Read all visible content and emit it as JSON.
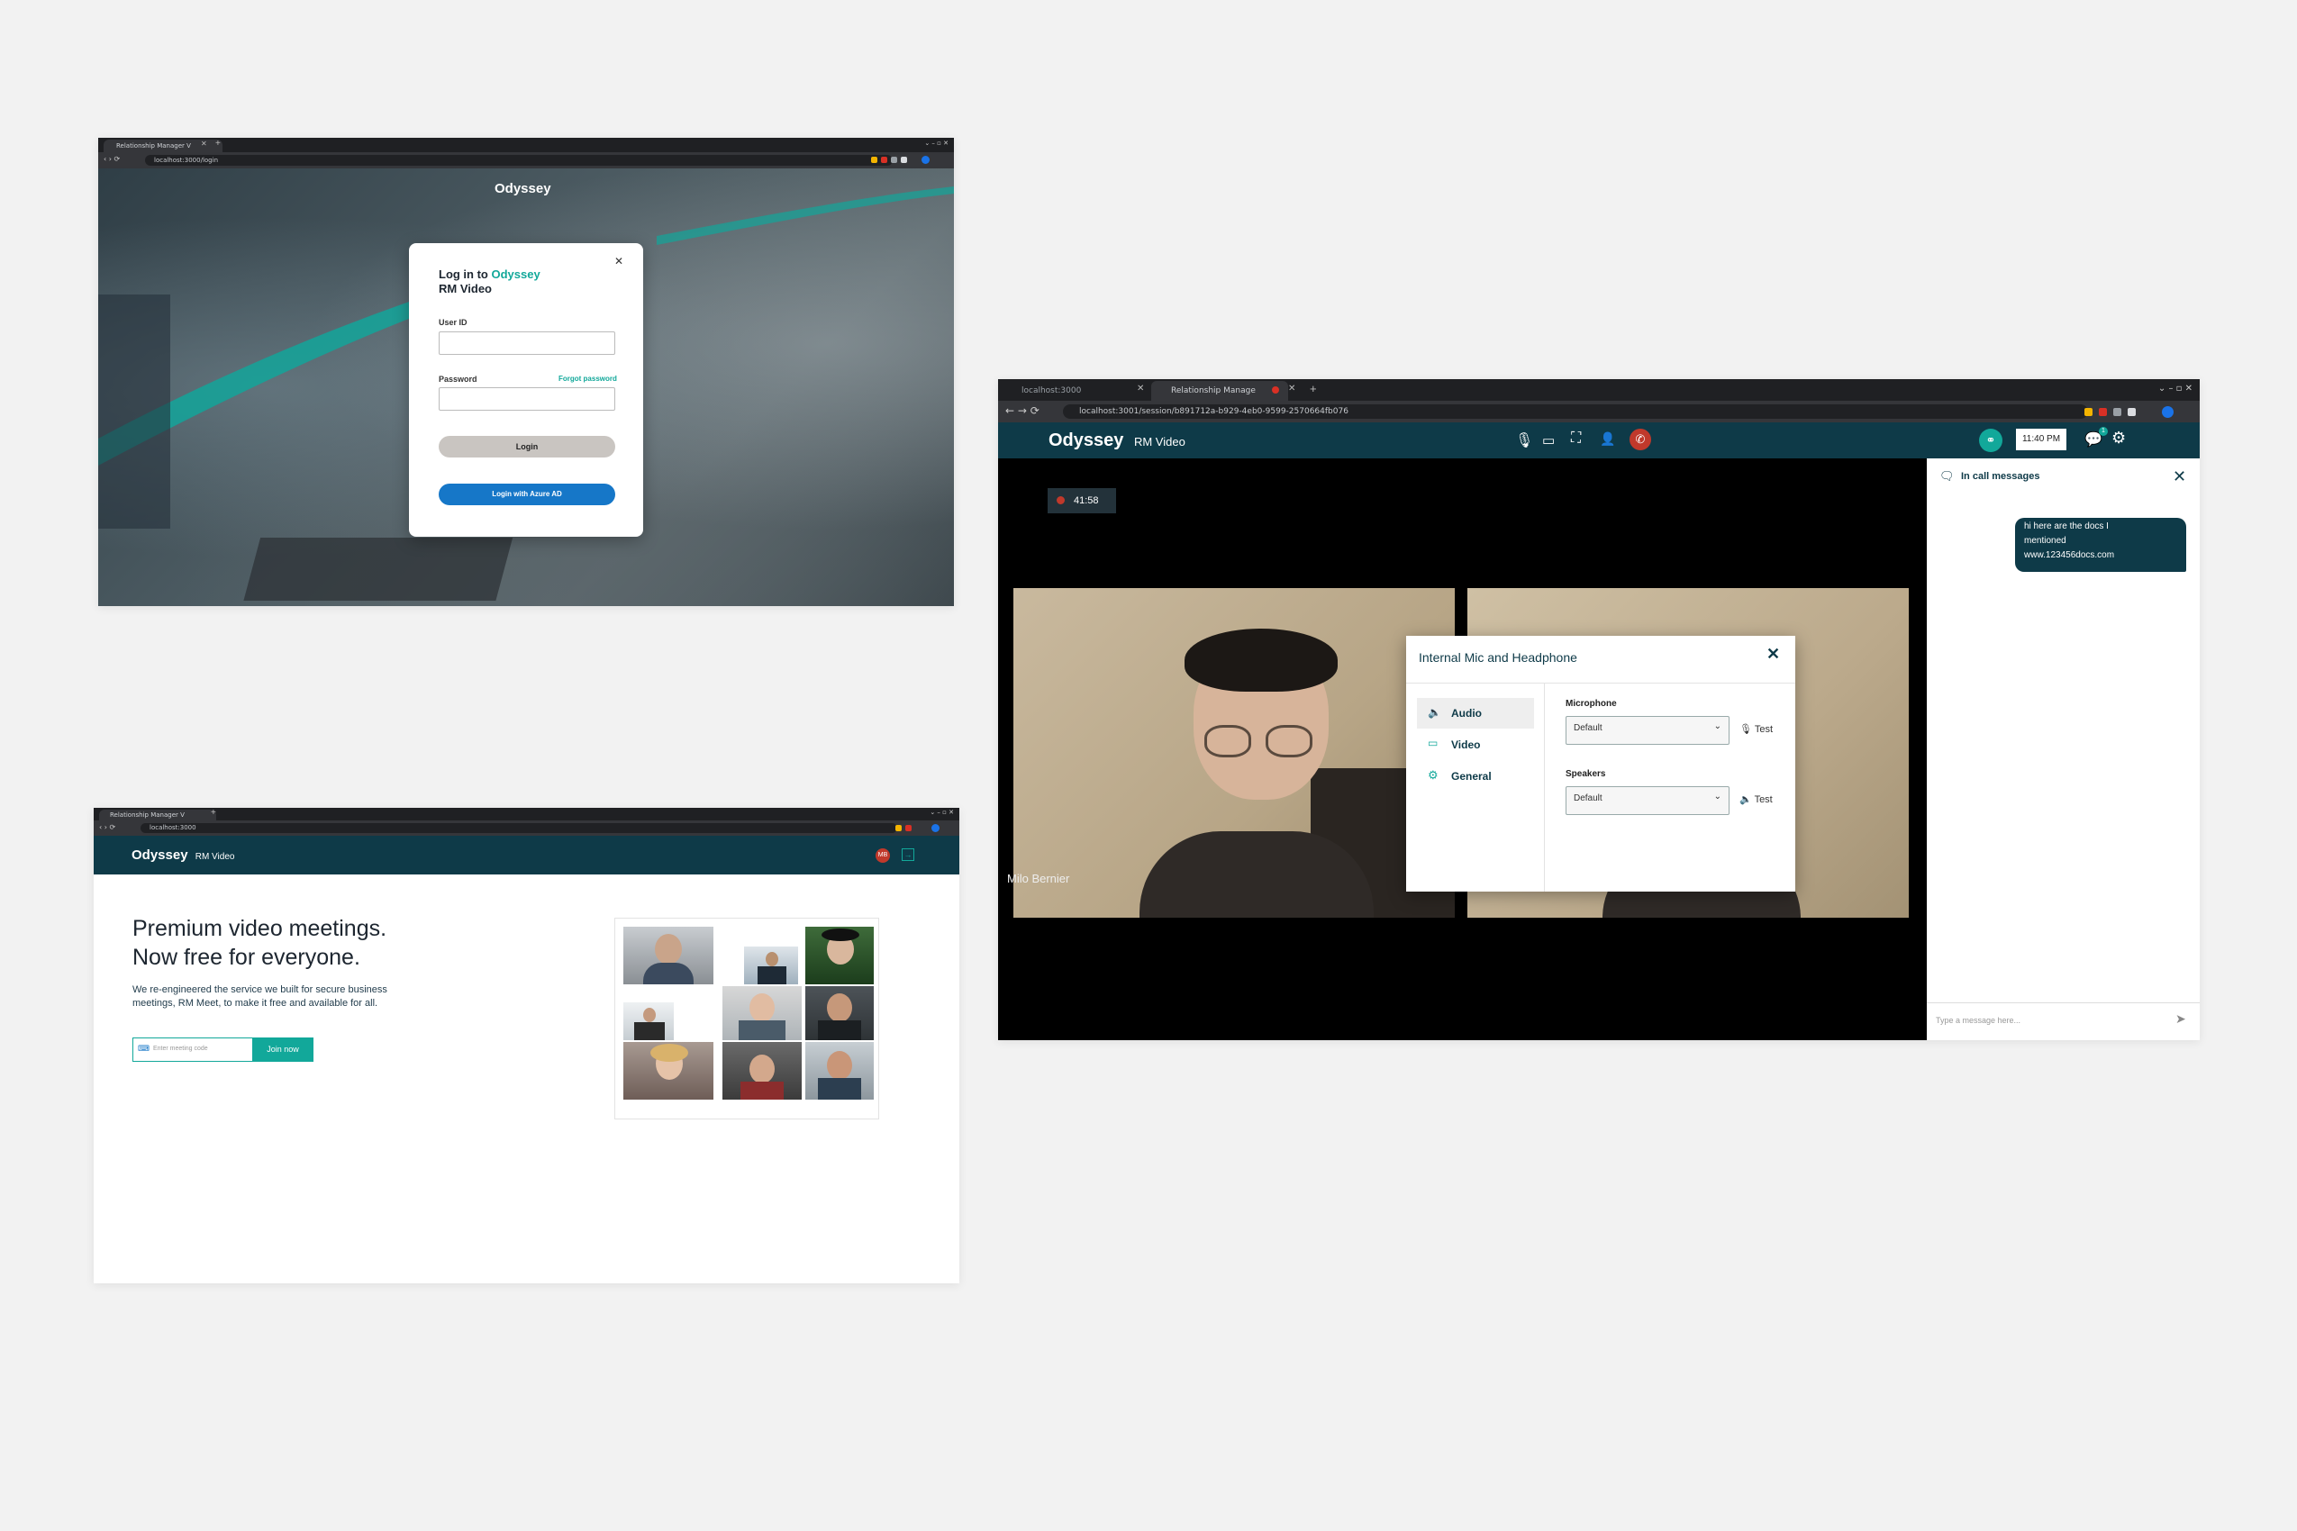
{
  "screen_login": {
    "tab_title": "Relationship Manager V",
    "url": "localhost:3000/login",
    "logo": "Odyssey",
    "modal": {
      "heading_prefix": "Log in to ",
      "heading_brand": "Odyssey",
      "heading_line2": "RM Video",
      "user_id_label": "User ID",
      "user_id_value": "",
      "password_label": "Password",
      "password_value": "",
      "forgot_link": "Forgot password",
      "login_button": "Login",
      "azure_button": "Login with Azure AD"
    }
  },
  "screen_home": {
    "tab_title": "Relationship Manager V",
    "url": "localhost:3000",
    "brand": "Odyssey",
    "product": "RM Video",
    "avatar_initials": "MB",
    "hero_line1": "Premium video meetings.",
    "hero_line2": "Now free for everyone.",
    "sub_line1": "We re-engineered the service we built for secure business",
    "sub_line2": "meetings, RM Meet, to make it free and available for all.",
    "meeting_placeholder": "Enter meeting code",
    "join_button": "Join now"
  },
  "screen_call": {
    "tabs": [
      {
        "title": "localhost:3000"
      },
      {
        "title": "Relationship Manage"
      }
    ],
    "url": "localhost:3001/session/b891712a-b929-4eb0-9599-2570664fb076",
    "brand": "Odyssey",
    "product": "RM Video",
    "time": "11:40 PM",
    "chat_badge": "1",
    "recording_time": "41:58",
    "participant_name": "Milo Bernier",
    "chat": {
      "title": "In call messages",
      "message_line1": "hi here are the docs I",
      "message_line2": "mentioned",
      "message_line3": "www.123456docs.com",
      "input_placeholder": "Type a message here..."
    },
    "settings_modal": {
      "title": "Internal Mic and Headphone",
      "menu": [
        "Audio",
        "Video",
        "General"
      ],
      "microphone_label": "Microphone",
      "microphone_value": "Default",
      "speakers_label": "Speakers",
      "speakers_value": "Default",
      "test_label": "Test"
    }
  },
  "colors": {
    "teal": "#12a89a",
    "navy": "#0e3a48",
    "blue": "#1677c8",
    "record_red": "#c0392b"
  }
}
